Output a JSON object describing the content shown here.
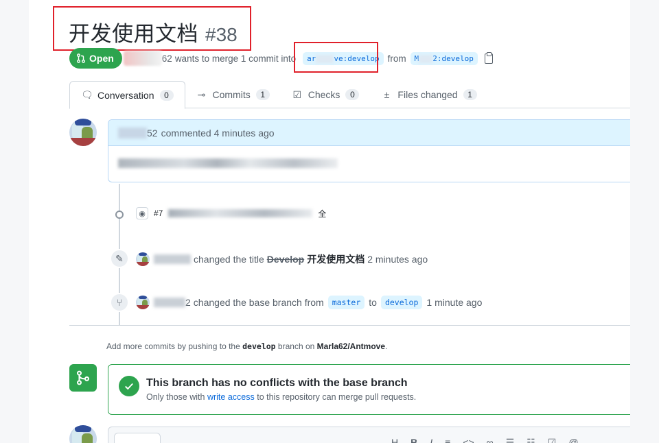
{
  "pr": {
    "title": "开发使用文档",
    "number": "#38",
    "state_label": "Open",
    "author_suffix": "62",
    "merge_text": "wants to merge 1 commit into",
    "base_branch_visible": "ar",
    "base_branch_tail": "ve:develop",
    "from_text": "from",
    "head_branch_visible": "M",
    "head_branch_tail": "2:develop"
  },
  "tabs": [
    {
      "label": "Conversation",
      "count": "0"
    },
    {
      "label": "Commits",
      "count": "1"
    },
    {
      "label": "Checks",
      "count": "0"
    },
    {
      "label": "Files changed",
      "count": "1"
    }
  ],
  "comment": {
    "author_suffix": "52",
    "meta": "commented 4 minutes ago"
  },
  "commit": {
    "hash_prefix": "#7",
    "title_tail": "全"
  },
  "events": {
    "title_change": {
      "action": "changed the title",
      "old_title": "Develop",
      "new_title": "开发使用文档",
      "time": "2 minutes ago"
    },
    "base_change": {
      "user_suffix": "2",
      "action": "changed the base branch from",
      "from_branch": "master",
      "to_word": "to",
      "to_branch": "develop",
      "time": "1 minute ago"
    }
  },
  "push_hint": {
    "prefix": "Add more commits by pushing to the",
    "branch": "develop",
    "middle": "branch on",
    "repo": "Marla62/Antmove",
    "suffix": "."
  },
  "merge_status": {
    "title": "This branch has no conflicts with the base branch",
    "sub_prefix": "Only those with",
    "sub_link": "write access",
    "sub_suffix": "to this repository can merge pull requests."
  },
  "colors": {
    "open_green": "#2da44e",
    "link_blue": "#0969da",
    "annotation_red": "#e0202a"
  }
}
